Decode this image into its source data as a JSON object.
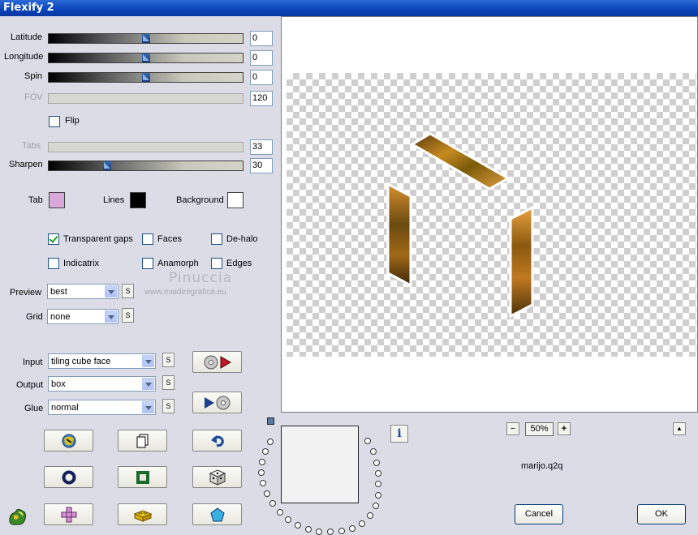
{
  "window": {
    "title": "Flexify 2"
  },
  "sliders": [
    {
      "label": "Latitude",
      "value": "0",
      "level": 0.5,
      "enabled": true
    },
    {
      "label": "Longitude",
      "value": "0",
      "level": 0.5,
      "enabled": true
    },
    {
      "label": "Spin",
      "value": "0",
      "level": 0.5,
      "enabled": true
    },
    {
      "label": "FOV",
      "value": "120",
      "enabled": false
    },
    {
      "label": "Tabs",
      "value": "33",
      "enabled": false
    },
    {
      "label": "Sharpen",
      "value": "30",
      "level": 0.3,
      "enabled": true
    }
  ],
  "flip": {
    "label": "Flip",
    "checked": false
  },
  "colors": {
    "tab_label": "Tab",
    "tab_color": "#d8a8d8",
    "lines_label": "Lines",
    "lines_color": "#000000",
    "background_label": "Background",
    "background_color": "#ffffff"
  },
  "options": {
    "transparent_gaps": {
      "label": "Transparent gaps",
      "checked": true
    },
    "faces": {
      "label": "Faces",
      "checked": false
    },
    "de_halo": {
      "label": "De-halo",
      "checked": false
    },
    "indicatrix": {
      "label": "Indicatrix",
      "checked": false
    },
    "anamorph": {
      "label": "Anamorph",
      "checked": false
    },
    "edges": {
      "label": "Edges",
      "checked": false
    }
  },
  "preview": {
    "label": "Preview",
    "value": "best"
  },
  "grid": {
    "label": "Grid",
    "value": "none"
  },
  "input": {
    "label": "Input",
    "value": "tiling cube face"
  },
  "output": {
    "label": "Output",
    "value": "box"
  },
  "glue": {
    "label": "Glue",
    "value": "normal"
  },
  "s_label": "S",
  "watermark": {
    "name": "Pinuccia",
    "url": "www.maidiregrafica.eu"
  },
  "zoom": {
    "minus": "−",
    "value": "50%",
    "plus": "+"
  },
  "up_label": "▲",
  "preset_file": "marijo.q2q",
  "info_label": "i",
  "buttons": {
    "cancel": "Cancel",
    "ok": "OK"
  }
}
